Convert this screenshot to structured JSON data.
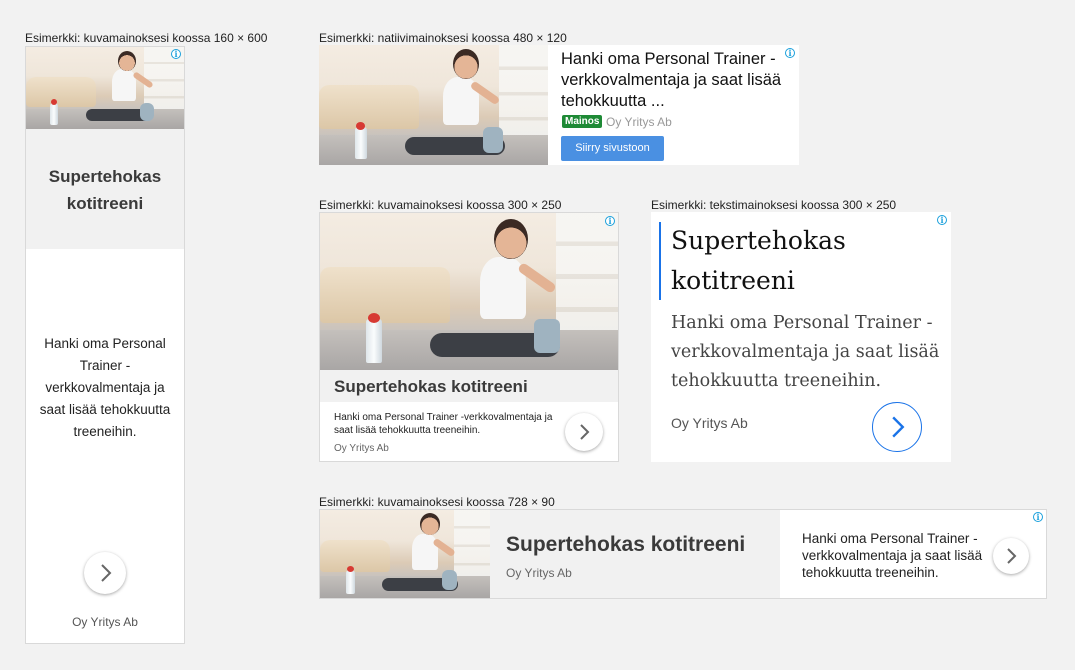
{
  "captions": {
    "ad_160x600": "Esimerkki: kuvamainoksesi koossa 160 × 600",
    "ad_480x120": "Esimerkki: natiivimainoksesi koossa 480 × 120",
    "ad_300x250_image": "Esimerkki: kuvamainoksesi koossa 300 × 250",
    "ad_300x250_text": "Esimerkki: tekstimainoksesi koossa 300 × 250",
    "ad_728x90": "Esimerkki: kuvamainoksesi koossa 728 × 90"
  },
  "ad": {
    "title": "Supertehokas kotitreeni",
    "title_line1": "Supertehokas",
    "title_line2": "kotitreeni",
    "description": "Hanki oma Personal Trainer -verkkovalmentaja ja saat lisää tehokkuutta treeneihin.",
    "native_headline": "Hanki oma Personal Trainer -verkkovalmentaja ja saat lisää tehokkuutta ...",
    "advertiser": "Oy Yritys Ab",
    "badge": "Mainos",
    "cta": "Siirry sivustoon",
    "info_glyph": "i"
  },
  "icons": {
    "info": "info-icon",
    "arrow": "chevron-right-icon"
  },
  "colors": {
    "background": "#f2f2f2",
    "info": "#1aa0dc",
    "badge": "#1e8a36",
    "cta": "#4a90e2",
    "accent": "#1a73e8"
  }
}
